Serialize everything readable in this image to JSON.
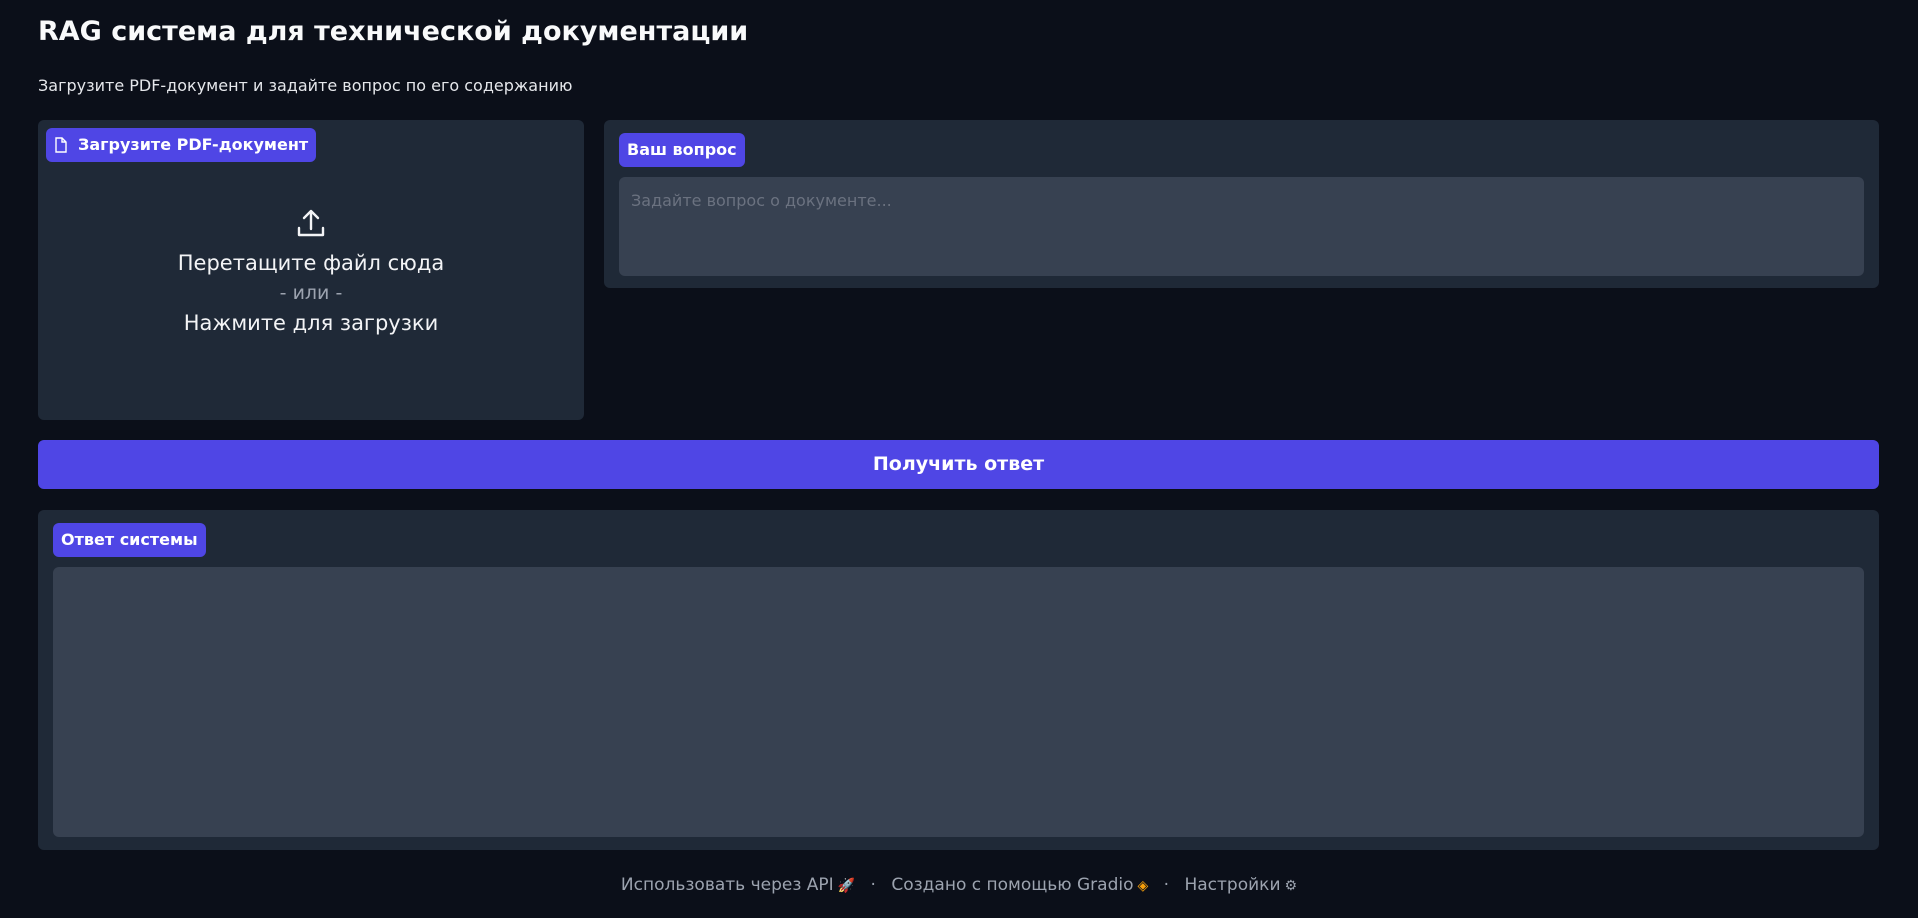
{
  "header": {
    "title": "RAG система для технической документации",
    "subtitle": "Загрузите PDF-документ и задайте вопрос по его содержанию"
  },
  "upload": {
    "label": "Загрузите PDF-документ",
    "label_icon": "file-icon",
    "upload_icon": "upload-icon",
    "drop_text": "Перетащите файл сюда",
    "or_text": "- или -",
    "click_text": "Нажмите для загрузки"
  },
  "question": {
    "label": "Ваш вопрос",
    "placeholder": "Задайте вопрос о документе...",
    "value": ""
  },
  "submit": {
    "label": "Получить ответ"
  },
  "answer": {
    "label": "Ответ системы",
    "value": ""
  },
  "footer": {
    "api_link": "Использовать через API",
    "api_icon": "rocket-icon",
    "built_with": "Создано с помощью Gradio",
    "gradio_icon": "gradio-logo-icon",
    "settings": "Настройки",
    "settings_icon": "gear-icon",
    "separator": "·"
  },
  "colors": {
    "background": "#0b0f19",
    "panel": "#1f2937",
    "input": "#374151",
    "accent": "#4f46e5"
  }
}
